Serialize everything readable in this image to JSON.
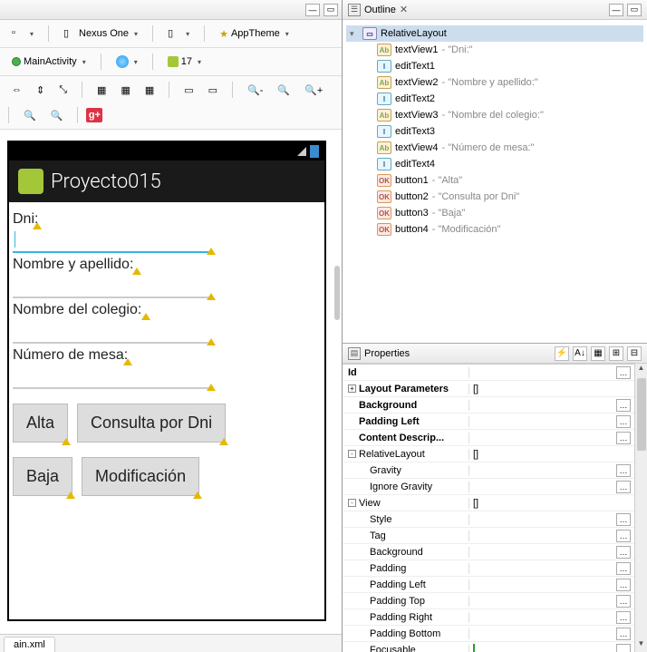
{
  "left": {
    "toolbar1": {
      "device": "Nexus One",
      "theme_star": "★",
      "theme": "AppTheme"
    },
    "toolbar2": {
      "activity": "MainActivity",
      "api": "17"
    },
    "gplus": "g+",
    "phone": {
      "title": "Proyecto015",
      "labels": {
        "dni": "Dni:",
        "nombre": "Nombre y apellido:",
        "colegio": "Nombre del colegio:",
        "mesa": "Número de mesa:"
      },
      "buttons": {
        "alta": "Alta",
        "consulta": "Consulta por Dni",
        "baja": "Baja",
        "modif": "Modificación"
      }
    },
    "bottom_tab": "ain.xml"
  },
  "outline": {
    "title": "Outline",
    "root": "RelativeLayout",
    "items": [
      {
        "id": "textView1",
        "kind": "text",
        "suffix": " - \"Dni:\""
      },
      {
        "id": "editText1",
        "kind": "edit",
        "suffix": ""
      },
      {
        "id": "textView2",
        "kind": "text",
        "suffix": " - \"Nombre y apellido:\""
      },
      {
        "id": "editText2",
        "kind": "edit",
        "suffix": ""
      },
      {
        "id": "textView3",
        "kind": "text",
        "suffix": " - \"Nombre del colegio:\""
      },
      {
        "id": "editText3",
        "kind": "edit",
        "suffix": ""
      },
      {
        "id": "textView4",
        "kind": "text",
        "suffix": " - \"Número de mesa:\""
      },
      {
        "id": "editText4",
        "kind": "edit",
        "suffix": ""
      },
      {
        "id": "button1",
        "kind": "btn",
        "suffix": " - \"Alta\""
      },
      {
        "id": "button2",
        "kind": "btn",
        "suffix": " - \"Consulta por Dni\""
      },
      {
        "id": "button3",
        "kind": "btn",
        "suffix": " - \"Baja\""
      },
      {
        "id": "button4",
        "kind": "btn",
        "suffix": " - \"Modificación\""
      }
    ]
  },
  "props": {
    "title": "Properties",
    "rows": [
      {
        "name": "Id",
        "bold": true,
        "indent": 6,
        "val": "",
        "btn": true
      },
      {
        "name": "Layout Parameters",
        "bold": true,
        "indent": 6,
        "val": "[]",
        "expand": "+"
      },
      {
        "name": "Background",
        "bold": true,
        "indent": 18,
        "val": "",
        "btn": true
      },
      {
        "name": "Padding Left",
        "bold": true,
        "indent": 18,
        "val": "",
        "btn": true
      },
      {
        "name": "Content Descrip...",
        "bold": true,
        "indent": 18,
        "val": "",
        "btn": true
      },
      {
        "name": "RelativeLayout",
        "bold": false,
        "indent": 6,
        "val": "[]",
        "expand": "-"
      },
      {
        "name": "Gravity",
        "bold": false,
        "indent": 30,
        "val": "",
        "btn": true
      },
      {
        "name": "Ignore Gravity",
        "bold": false,
        "indent": 30,
        "val": "",
        "btn": true
      },
      {
        "name": "View",
        "bold": false,
        "indent": 6,
        "val": "[]",
        "expand": "-"
      },
      {
        "name": "Style",
        "bold": false,
        "indent": 30,
        "val": "",
        "btn": true
      },
      {
        "name": "Tag",
        "bold": false,
        "indent": 30,
        "val": "",
        "btn": true
      },
      {
        "name": "Background",
        "bold": false,
        "indent": 30,
        "val": "",
        "btn": true
      },
      {
        "name": "Padding",
        "bold": false,
        "indent": 30,
        "val": "",
        "btn": true
      },
      {
        "name": "Padding Left",
        "bold": false,
        "indent": 30,
        "val": "",
        "btn": true
      },
      {
        "name": "Padding Top",
        "bold": false,
        "indent": 30,
        "val": "",
        "btn": true
      },
      {
        "name": "Padding Right",
        "bold": false,
        "indent": 30,
        "val": "",
        "btn": true
      },
      {
        "name": "Padding Bottom",
        "bold": false,
        "indent": 30,
        "val": "",
        "btn": true
      },
      {
        "name": "Focusable",
        "bold": false,
        "indent": 30,
        "greensq": true,
        "btn": true
      }
    ]
  }
}
